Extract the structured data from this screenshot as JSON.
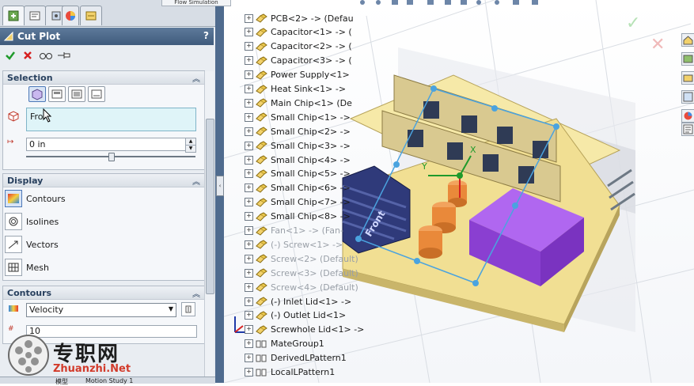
{
  "top_tabs": {
    "flow_tab": "Flow Simulation"
  },
  "property_manager": {
    "title": "Cut Plot",
    "help": "?"
  },
  "selection": {
    "title": "Selection",
    "plane_value": "Fron",
    "offset_value": "0 in"
  },
  "display": {
    "title": "Display",
    "items": [
      {
        "label": "Contours",
        "icon": "contours-icon"
      },
      {
        "label": "Isolines",
        "icon": "isolines-icon"
      },
      {
        "label": "Vectors",
        "icon": "vectors-icon"
      },
      {
        "label": "Mesh",
        "icon": "mesh-icon"
      }
    ]
  },
  "contours": {
    "title": "Contours",
    "parameter": "Velocity",
    "levels": "10"
  },
  "bottom_tabs": [
    "模型",
    "Motion Study 1"
  ],
  "tree": [
    {
      "label": "PCB<2> -> (Defau",
      "dim": false
    },
    {
      "label": "Capacitor<1> -> (",
      "dim": false
    },
    {
      "label": "Capacitor<2> -> (",
      "dim": false
    },
    {
      "label": "Capacitor<3> -> (",
      "dim": false
    },
    {
      "label": "Power Supply<1>",
      "dim": false
    },
    {
      "label": "Heat Sink<1> ->",
      "dim": false
    },
    {
      "label": "Main Chip<1> (De",
      "dim": false
    },
    {
      "label": "Small Chip<1> ->",
      "dim": false
    },
    {
      "label": "Small Chip<2> ->",
      "dim": false
    },
    {
      "label": "Small Chip<3> ->",
      "dim": false
    },
    {
      "label": "Small Chip<4> ->",
      "dim": false
    },
    {
      "label": "Small Chip<5> ->",
      "dim": false
    },
    {
      "label": "Small Chip<6> ->",
      "dim": false
    },
    {
      "label": "Small Chip<7> ->",
      "dim": false
    },
    {
      "label": "Small Chip<8> ->",
      "dim": false
    },
    {
      "label": "Fan<1> -> (Fan-",
      "dim": true
    },
    {
      "label": "(-) Screw<1> ->",
      "dim": true
    },
    {
      "label": "Screw<2> (Default)",
      "dim": true
    },
    {
      "label": "Screw<3> (Default)",
      "dim": true
    },
    {
      "label": "Screw<4> (Default)",
      "dim": true
    },
    {
      "label": "(-) Inlet Lid<1> ->",
      "dim": false
    },
    {
      "label": "(-) Outlet Lid<1>",
      "dim": false
    },
    {
      "label": "Screwhole Lid<1> ->",
      "dim": false
    },
    {
      "label": "MateGroup1",
      "dim": false
    },
    {
      "label": "DerivedLPattern1",
      "dim": false
    },
    {
      "label": "LocalLPattern1",
      "dim": false
    }
  ],
  "viewport": {
    "axis_x": "X",
    "axis_y": "Y",
    "heatsink_label": "Front"
  },
  "watermark": {
    "cn": "专职网",
    "en": "Zhuanzhi.Net"
  },
  "colors": {
    "board": "#f1df93",
    "box": "#9b45e6",
    "heatsink": "#2f3a7a",
    "cap": "#e9893a",
    "accent_header": "#4a6688"
  }
}
